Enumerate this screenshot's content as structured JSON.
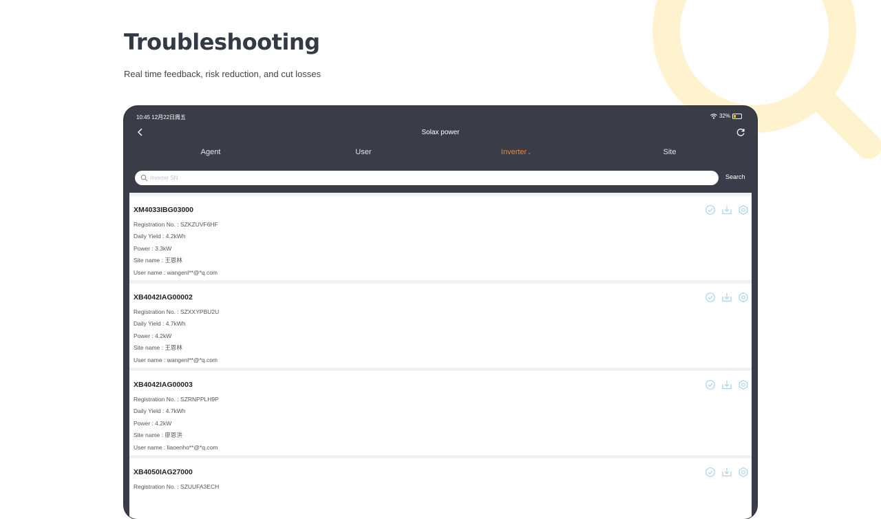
{
  "hero": {
    "title": "Troubleshooting",
    "subtitle": "Real time feedback, risk reduction, and cut losses"
  },
  "colors": {
    "accent": "#e8883a",
    "app_bar": "#3a3d47",
    "action_icon": "#a9d4ee",
    "decoration": "#fff3cf"
  },
  "device": {
    "status_bar": {
      "time": "10:45  12月22日周五",
      "battery": "32%"
    },
    "nav": {
      "title": "Solax power",
      "back_icon": "chevron-left-icon",
      "refresh_icon": "refresh-icon"
    },
    "tabs": [
      {
        "label": "Agent"
      },
      {
        "label": "User"
      },
      {
        "label": "Inverter",
        "active": true,
        "dropdown": true
      },
      {
        "label": "Site"
      }
    ],
    "search": {
      "placeholder": "Inverter SN",
      "value": "",
      "button_label": "Search"
    },
    "cards": [
      {
        "sn": "XM4033IBG03000",
        "fields": [
          "Registration No. : SZKZUVF6HF",
          "Daily Yield : 4.2kWh",
          "Power : 3.3kW",
          "Site name : 王恩林",
          "User name : wangenl**@*q.com"
        ]
      },
      {
        "sn": "XB4042IAG00002",
        "fields": [
          "Registration No. : SZXXYPBU2U",
          "Daily Yield : 4.7kWh",
          "Power : 4.2kW",
          "Site name : 王恩林",
          "User name : wangenl**@*q.com"
        ]
      },
      {
        "sn": "XB4042IAG00003",
        "fields": [
          "Registration No. : SZRNPPLH9P",
          "Daily Yield : 4.7kWh",
          "Power : 4.2kW",
          "Site name : 廖恩洪",
          "User name : liaoenho**@*q.com"
        ]
      },
      {
        "sn": "XB4050IAG27000",
        "fields": [
          "Registration No. : SZUUFA3ECH"
        ]
      }
    ],
    "card_actions": [
      "check-circle-icon",
      "download-icon",
      "settings-gear-icon"
    ]
  }
}
